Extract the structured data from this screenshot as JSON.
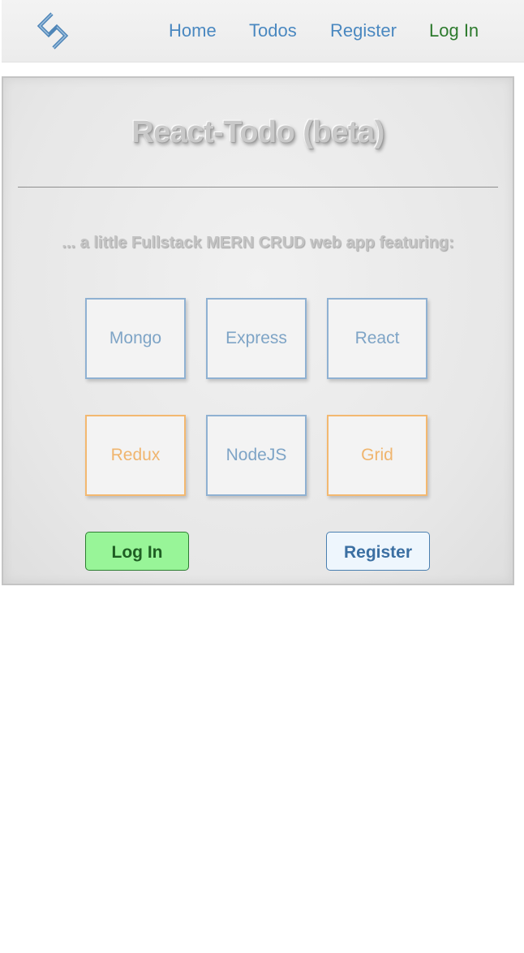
{
  "nav": {
    "logo_icon": "diamond-logo-icon",
    "links": [
      {
        "label": "Home"
      },
      {
        "label": "Todos"
      },
      {
        "label": "Register"
      },
      {
        "label": "Log In"
      }
    ]
  },
  "card": {
    "title": "React-Todo (beta)",
    "subtitle": "... a little Fullstack MERN CRUD web app featuring:",
    "tiles": [
      {
        "label": "Mongo"
      },
      {
        "label": "Express"
      },
      {
        "label": "React"
      },
      {
        "label": "Redux"
      },
      {
        "label": "NodeJS"
      },
      {
        "label": "Grid"
      }
    ],
    "buttons": {
      "login": "Log In",
      "register": "Register"
    }
  },
  "colors": {
    "link_blue": "#4a88c0",
    "link_green": "#2d7a2d",
    "tile_blue": "#8fb1d2",
    "tile_orange": "#f3b870",
    "login_button_bg": "#98f598",
    "register_button_bg": "#eef6fd"
  }
}
